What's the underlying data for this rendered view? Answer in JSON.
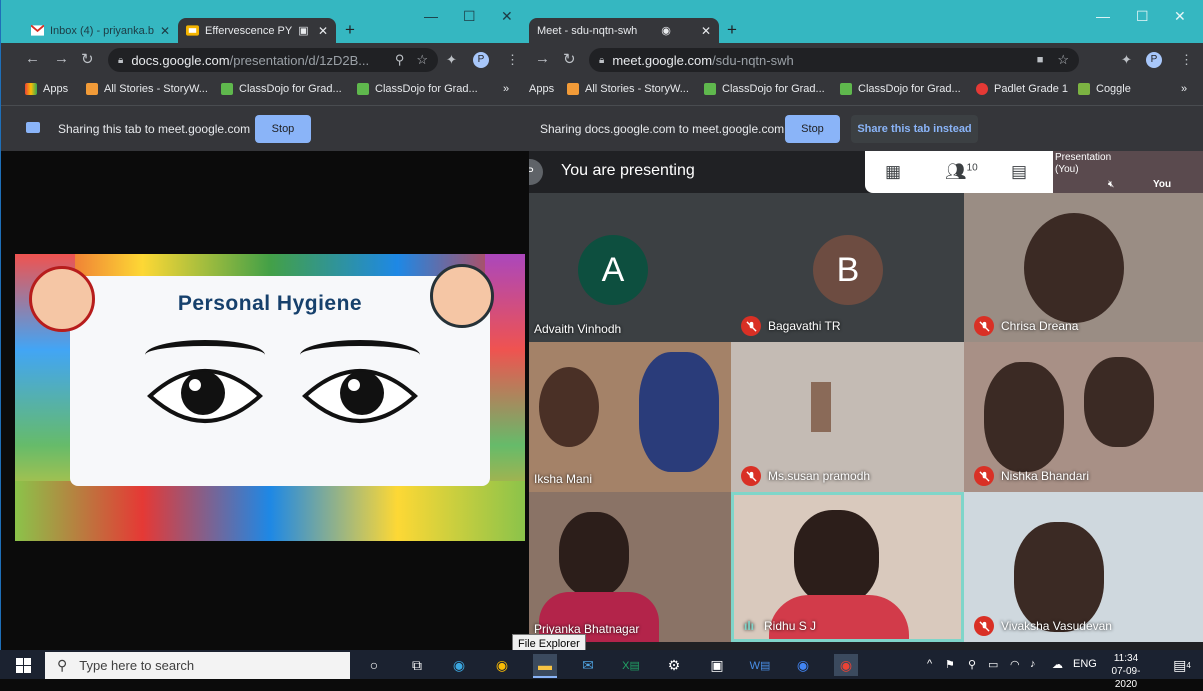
{
  "left_window": {
    "tabs": [
      {
        "label": "Inbox (4) - priyanka.b",
        "icon": "gmail-icon"
      },
      {
        "label": "Effervescence PY",
        "icon": "slides-icon"
      }
    ],
    "url_host": "docs.google.com",
    "url_path": "/presentation/d/1zD2B...",
    "avatar": "P",
    "bookmarks": [
      "Apps",
      "All Stories - StoryW...",
      "ClassDojo for Grad...",
      "ClassDojo for Grad...",
      "»"
    ],
    "share_text": "Sharing this tab to meet.google.com",
    "stop_label": "Stop",
    "slide_title": "Personal Hygiene"
  },
  "right_window": {
    "tabs": [
      {
        "label": "Meet - sdu-nqtn-swh"
      }
    ],
    "url_host": "meet.google.com",
    "url_path": "/sdu-nqtn-swh",
    "avatar": "P",
    "bookmarks": [
      "Apps",
      "All Stories - StoryW...",
      "ClassDojo for Grad...",
      "ClassDojo for Grad...",
      "Padlet Grade 1",
      "Coggle",
      "»"
    ],
    "share_text": "Sharing docs.google.com to meet.google.com",
    "stop_label": "Stop",
    "instead_label": "Share this tab instead",
    "presenting_label": "You are presenting",
    "presenter_chip": "P",
    "participant_count": "10",
    "presentation_label": "Presentation (You)",
    "you_label": "You"
  },
  "participants": [
    {
      "name": "Advaith Vinhodh",
      "initial": "A",
      "muted": false,
      "avatar_color": "#0d4f3f",
      "bg": "#3c4043"
    },
    {
      "name": "Bagavathi TR",
      "initial": "B",
      "muted": true,
      "avatar_color": "#6d4c41",
      "bg": "#3c4043"
    },
    {
      "name": "Chrisa Dreana",
      "muted": true,
      "bg": "#9a8d84"
    },
    {
      "name": "Iksha Mani",
      "muted": false,
      "bg": "#a48268"
    },
    {
      "name": "Ms.susan pramodh",
      "muted": true,
      "bg": "#c4bbb4"
    },
    {
      "name": "Nishka Bhandari",
      "muted": true,
      "bg": "#a89086"
    },
    {
      "name": "Priyanka Bhatnagar",
      "muted": false,
      "bg": "#8a7366"
    },
    {
      "name": "Ridhu S J",
      "muted": false,
      "speaking": true,
      "bg": "#d9c9bd"
    },
    {
      "name": "Vivaksha Vasudevan",
      "muted": true,
      "bg": "#cfd8de"
    }
  ],
  "taskbar": {
    "search_placeholder": "Type here to search",
    "tooltip": "File Explorer",
    "language": "ENG",
    "time": "11:34",
    "date": "07-09-2020",
    "notifications": "4"
  }
}
